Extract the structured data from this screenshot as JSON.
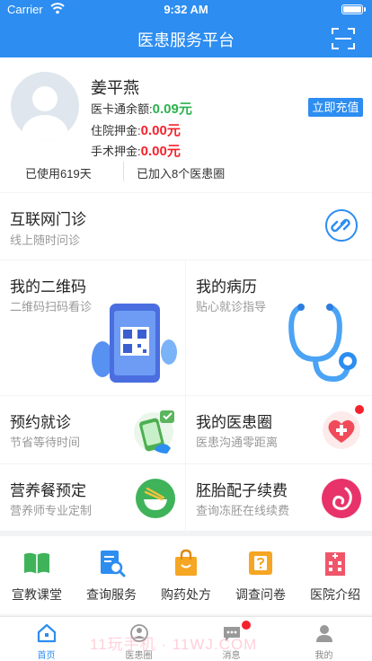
{
  "status_bar": {
    "carrier": "Carrier",
    "time": "9:32 AM"
  },
  "nav": {
    "title": "医患服务平台",
    "scan_icon": "scan-icon"
  },
  "profile": {
    "name": "姜平燕",
    "card_balance_label": "医卡通余额:",
    "card_balance_value": "0.09元",
    "hospital_deposit_label": "住院押金:",
    "hospital_deposit_value": "0.00元",
    "surgery_deposit_label": "手术押金:",
    "surgery_deposit_value": "0.00元",
    "recharge_label": "立即充值",
    "days_used": "已使用619天",
    "circles_joined": "已加入8个医患圈"
  },
  "tiles": {
    "online_clinic": {
      "title": "互联网门诊",
      "subtitle": "线上随时问诊"
    },
    "qr_code": {
      "title": "我的二维码",
      "subtitle": "二维码扫码看诊"
    },
    "medical_record": {
      "title": "我的病历",
      "subtitle": "贴心就诊指导"
    },
    "appointment": {
      "title": "预约就诊",
      "subtitle": "节省等待时间"
    },
    "doctor_circle": {
      "title": "我的医患圈",
      "subtitle": "医患沟通零距离"
    },
    "nutrition_meal": {
      "title": "营养餐预定",
      "subtitle": "营养师专业定制"
    },
    "embryo_fee": {
      "title": "胚胎配子续费",
      "subtitle": "查询冻胚在线续费"
    }
  },
  "bottom_icons": [
    {
      "label": "宣教课堂",
      "icon": "book-icon"
    },
    {
      "label": "查询服务",
      "icon": "search-document-icon"
    },
    {
      "label": "购药处方",
      "icon": "shopping-bag-icon"
    },
    {
      "label": "调查问卷",
      "icon": "survey-icon"
    },
    {
      "label": "医院介绍",
      "icon": "hospital-icon"
    }
  ],
  "tabbar": [
    {
      "label": "首页",
      "icon": "home-icon"
    },
    {
      "label": "医患圈",
      "icon": "circle-icon"
    },
    {
      "label": "消息",
      "icon": "message-icon"
    },
    {
      "label": "我的",
      "icon": "user-icon"
    }
  ],
  "watermark": "11玩手机 · 11WJ.COM",
  "colors": {
    "primary": "#2d8df0",
    "green": "#2bb24c",
    "red": "#f5222d",
    "background": "#f2f3f5"
  }
}
